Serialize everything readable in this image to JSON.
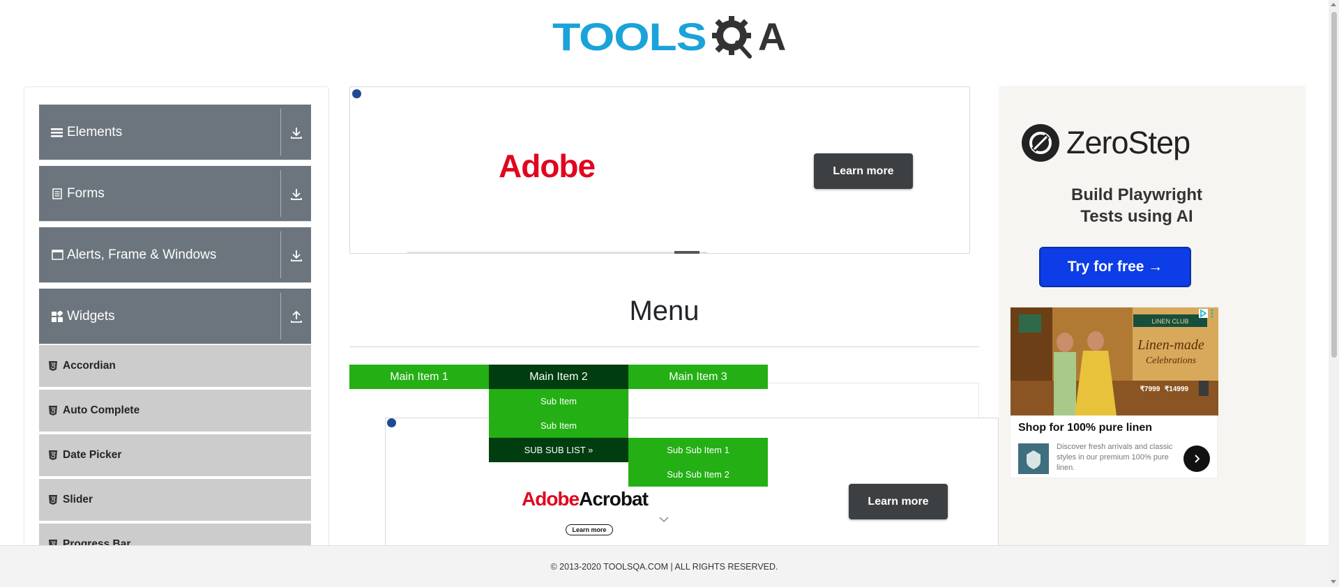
{
  "header": {
    "logo_text": "TOOLS",
    "logo_suffix": "A",
    "logo_gear_letter": "Q"
  },
  "sidebar": {
    "groups": [
      {
        "label": "Elements",
        "icon": "list-icon",
        "arrow": "download-icon"
      },
      {
        "label": "Forms",
        "icon": "document-icon",
        "arrow": "download-icon"
      },
      {
        "label": "Alerts, Frame & Windows",
        "icon": "window-icon",
        "arrow": "download-icon"
      },
      {
        "label": "Widgets",
        "icon": "widgets-icon",
        "arrow": "upload-icon"
      }
    ],
    "widget_items": [
      "Accordian",
      "Auto Complete",
      "Date Picker",
      "Slider",
      "Progress Bar"
    ]
  },
  "ad_top": {
    "brand": "Adobe",
    "cta": "Learn more"
  },
  "main": {
    "title": "Menu",
    "menu": {
      "items": [
        "Main Item 1",
        "Main Item 2",
        "Main Item 3"
      ],
      "sub_items": [
        "Sub Item",
        "Sub Item",
        "SUB SUB LIST »"
      ],
      "sub_sub_items": [
        "Sub Sub Item 1",
        "Sub Sub Item 2"
      ]
    }
  },
  "ad_bottom": {
    "brand_red": "Adobe",
    "brand_black": "Acrobat",
    "small_cta": "Learn more",
    "cta": "Learn more"
  },
  "right_ad": {
    "brand": "ZeroStep",
    "headline_line1": "Build Playwright",
    "headline_line2": "Tests using AI",
    "cta": "Try for free →",
    "linen": {
      "logo_text": "LINEN CLUB",
      "tagline_line1": "Linen-made",
      "tagline_line2": "Celebrations",
      "price1": "₹7999",
      "price2": "₹14999",
      "title": "Shop for 100% pure linen",
      "description": "Discover fresh arrivals and classic styles in our premium 100% pure linen."
    }
  },
  "footer": {
    "text": "© 2013-2020 TOOLSQA.COM | ALL RIGHTS RESERVED."
  },
  "colors": {
    "menu_green": "#24af15",
    "menu_dark": "#003d0f",
    "sidebar_group": "#6c757d",
    "sidebar_item": "#cccccc",
    "logo_blue": "#1aa3d8",
    "adobe_red": "#e0061f",
    "zerostep_blue": "#0d3de6"
  }
}
